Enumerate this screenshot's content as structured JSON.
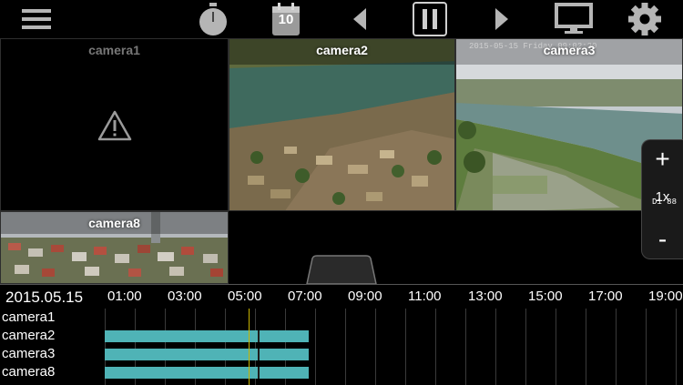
{
  "toolbar": {
    "icons": [
      "menu-icon",
      "stopwatch-icon",
      "calendar-icon",
      "previous-icon",
      "pause-icon",
      "next-icon",
      "monitor-icon",
      "gear-icon"
    ],
    "calendar_day": "10"
  },
  "cameras": {
    "camera1": {
      "label": "camera1",
      "status": "error"
    },
    "camera2": {
      "label": "camera2",
      "osd": ""
    },
    "camera3": {
      "label": "camera3",
      "osd": "2015-05-15 Friday 09:02:20",
      "osd_right": "D1 88"
    },
    "camera8": {
      "label": "camera8"
    }
  },
  "zoom": {
    "plus": "+",
    "level": "1x",
    "minus": "-"
  },
  "timeline": {
    "date": "2015.05.15",
    "hours": [
      "01:00",
      "03:00",
      "05:00",
      "07:00",
      "09:00",
      "11:00",
      "13:00",
      "15:00",
      "17:00",
      "19:00"
    ],
    "rows": [
      {
        "name": "camera1",
        "recording": []
      },
      {
        "name": "camera2",
        "recording": [
          {
            "start_h": 0.0,
            "end_h": 6.8
          }
        ]
      },
      {
        "name": "camera3",
        "recording": [
          {
            "start_h": 0.0,
            "end_h": 6.8
          }
        ]
      },
      {
        "name": "camera8",
        "recording": [
          {
            "start_h": 0.0,
            "end_h": 6.8
          }
        ]
      }
    ],
    "cursor_hour": 4.8,
    "colors": {
      "bar": "#4fb3b6",
      "cursor": "#c8b400"
    }
  }
}
